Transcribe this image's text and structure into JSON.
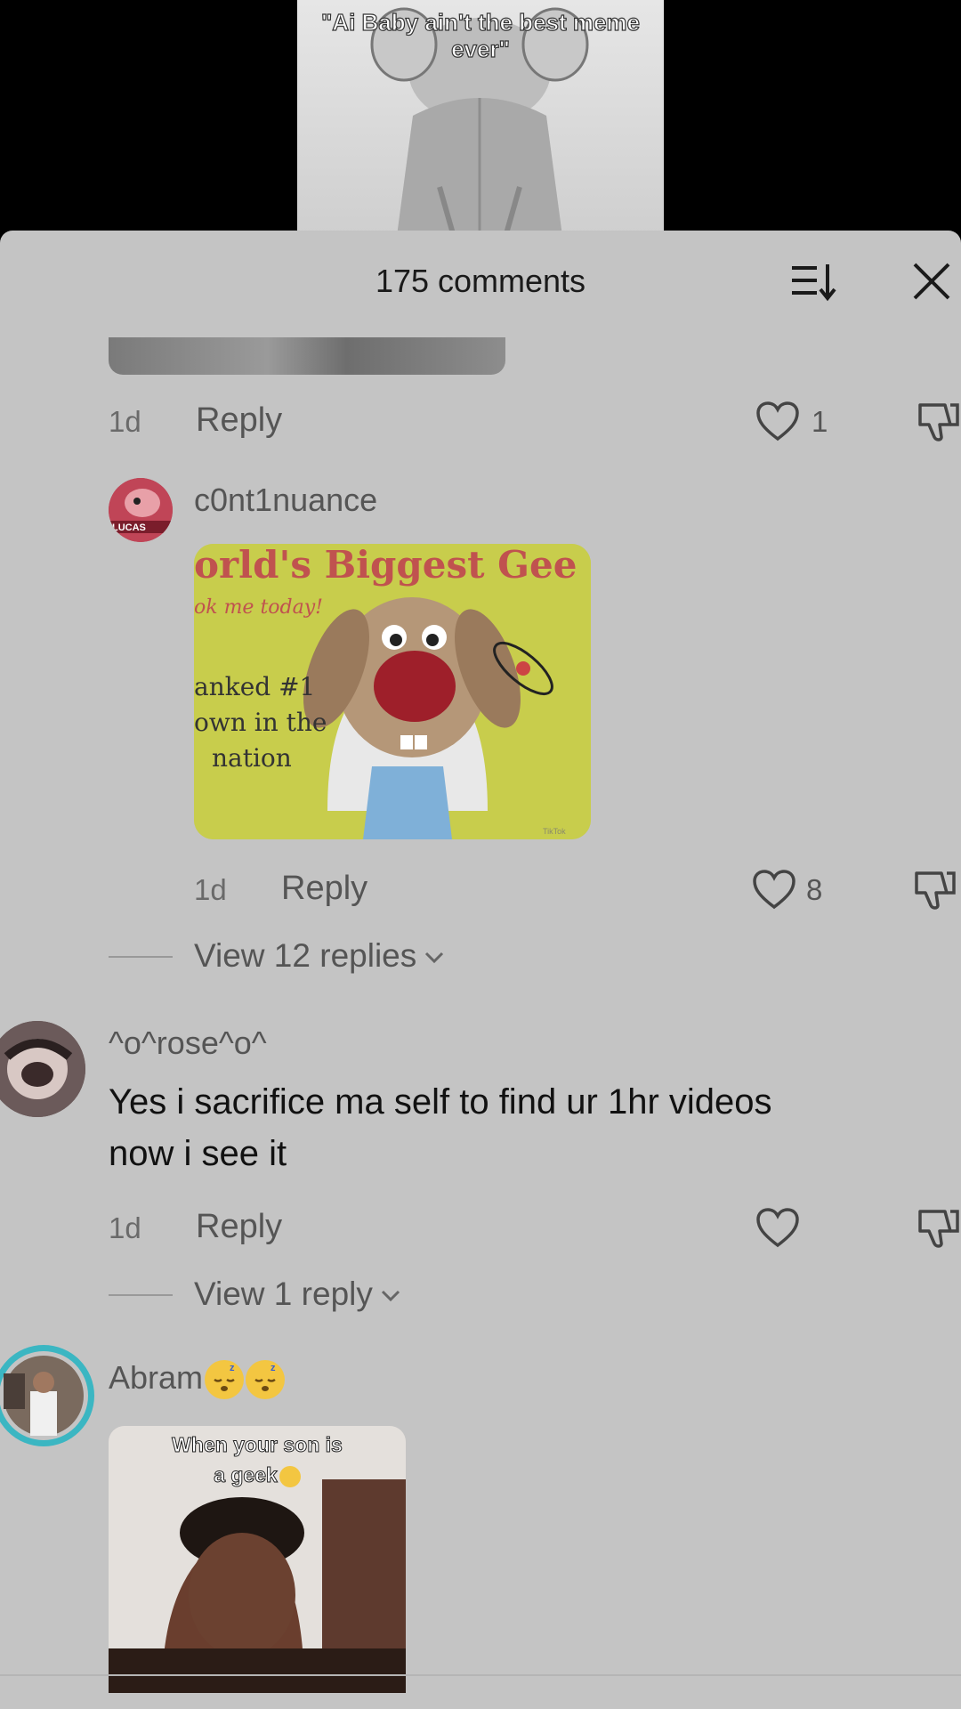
{
  "video": {
    "caption_line1": "\"Ai Baby ain't the best meme",
    "caption_line2": "ever\""
  },
  "header": {
    "title": "175 comments"
  },
  "comments": [
    {
      "time": "1d",
      "reply_label": "Reply",
      "likes": "1"
    },
    {
      "username": "c0nt1nuance",
      "avatar_badge": "LUCAS",
      "sticker": {
        "line1": "orld's Biggest Gee",
        "line2": "ok me today!",
        "line3": "anked #1",
        "line4": "own in the",
        "line5": "nation",
        "watermark": "TikTok"
      },
      "time": "1d",
      "reply_label": "Reply",
      "likes": "8",
      "view_replies": "View 12 replies"
    },
    {
      "username": "^o^rose^o^",
      "text_line1": "Yes i sacrifice ma self to find ur 1hr videos",
      "text_line2": "now i see it",
      "time": "1d",
      "reply_label": "Reply",
      "view_replies": "View 1 reply"
    },
    {
      "username": "Abram",
      "sticker_caption_line1": "When your son is",
      "sticker_caption_line2": "a geek"
    }
  ],
  "colors": {
    "sheet_bg": "#c4c4c4",
    "text_primary": "#111111",
    "text_secondary": "#555555"
  },
  "icons": [
    "sort-icon",
    "close-icon",
    "heart-icon",
    "dislike-icon",
    "chevron-down-icon",
    "sleeping-emoji-icon",
    "laughing-emoji-icon"
  ]
}
